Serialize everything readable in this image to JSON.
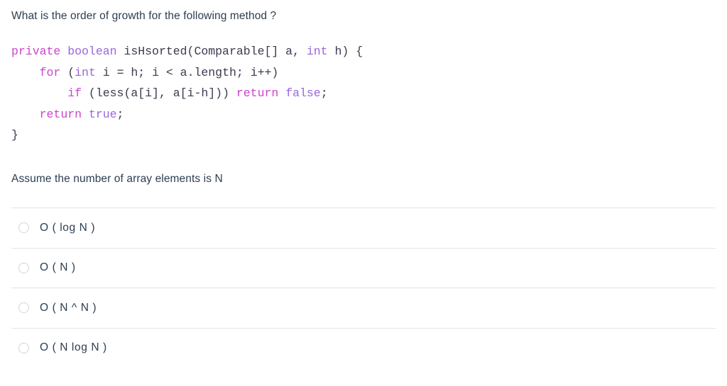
{
  "question": {
    "prompt": "What is the order of growth for the following method ?",
    "assumption": "Assume the number of array elements is N"
  },
  "code": {
    "language": "java",
    "lines": [
      {
        "indent": "",
        "tokens": [
          {
            "text": "private",
            "type": "keyword"
          },
          {
            "text": " ",
            "type": "plain"
          },
          {
            "text": "boolean",
            "type": "type"
          },
          {
            "text": " isHsorted(Comparable[] a, ",
            "type": "plain"
          },
          {
            "text": "int",
            "type": "type"
          },
          {
            "text": " h) {",
            "type": "plain"
          }
        ]
      },
      {
        "indent": "    ",
        "tokens": [
          {
            "text": "for",
            "type": "keyword"
          },
          {
            "text": " (",
            "type": "plain"
          },
          {
            "text": "int",
            "type": "type"
          },
          {
            "text": " i = h; i < a.length; i++)",
            "type": "plain"
          }
        ]
      },
      {
        "indent": "        ",
        "tokens": [
          {
            "text": "if",
            "type": "keyword"
          },
          {
            "text": " (less(a[i], a[i-h])) ",
            "type": "plain"
          },
          {
            "text": "return",
            "type": "keyword"
          },
          {
            "text": " ",
            "type": "plain"
          },
          {
            "text": "false",
            "type": "type"
          },
          {
            "text": ";",
            "type": "plain"
          }
        ]
      },
      {
        "indent": "    ",
        "tokens": [
          {
            "text": "return",
            "type": "keyword"
          },
          {
            "text": " ",
            "type": "plain"
          },
          {
            "text": "true",
            "type": "type"
          },
          {
            "text": ";",
            "type": "plain"
          }
        ]
      },
      {
        "indent": "",
        "tokens": [
          {
            "text": "}",
            "type": "brace"
          }
        ]
      }
    ]
  },
  "answers": {
    "selected": null,
    "options": [
      {
        "id": "opt-1",
        "label": "O ( log N )",
        "checked": false
      },
      {
        "id": "opt-2",
        "label": "O ( N )",
        "checked": false
      },
      {
        "id": "opt-3",
        "label": "O ( N ^ N )",
        "checked": false
      },
      {
        "id": "opt-4",
        "label": "O ( N log N )",
        "checked": false
      }
    ]
  },
  "colors": {
    "text": "#2c3e50",
    "keyword": "#cc44cc",
    "type": "#9966dd",
    "code_plain": "#3b3b4f",
    "divider": "#e3e5e8",
    "radio_border": "#d2d4d7",
    "background": "#ffffff"
  }
}
